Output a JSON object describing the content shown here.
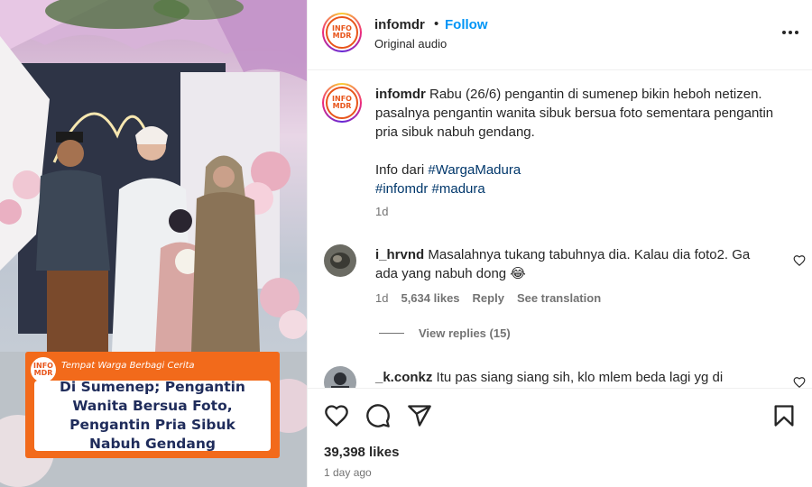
{
  "media": {
    "caption_tag": "Tempat Warga Berbagi Cerita",
    "caption_title": "Di Sumenep; Pengantin Wanita Bersua Foto, Pengantin Pria Sibuk Nabuh Gendang",
    "logo_line1": "INFO",
    "logo_line2": "MDR"
  },
  "header": {
    "username": "infomdr",
    "dot": "•",
    "follow_label": "Follow",
    "subtitle": "Original audio",
    "more_icon": "more-horizontal-icon"
  },
  "post_caption": {
    "username": "infomdr",
    "text": "Rabu (26/6) pengantin di sumenep bikin heboh netizen. pasalnya pengantin wanita sibuk bersua foto sementara pengantin pria sibuk nabuh gendang.",
    "info_prefix": "Info dari",
    "hashtag1": "#WargaMadura",
    "hashtag2": "#infomdr",
    "hashtag3": "#madura",
    "time": "1d"
  },
  "comments": [
    {
      "username": "i_hrvnd",
      "text": "Masalahnya tukang tabuhnya dia. Kalau dia foto2. Ga ada yang nabuh dong 😂",
      "time": "1d",
      "likes": "5,634 likes",
      "reply_label": "Reply",
      "translate_label": "See translation"
    },
    {
      "username": "_k.conkz",
      "text": "Itu pas siang siang sih, klo mlem beda lagi yg di"
    }
  ],
  "view_replies": "View replies (15)",
  "actions": {
    "like_icon": "heart-icon",
    "comment_icon": "comment-icon",
    "share_icon": "share-icon",
    "save_icon": "bookmark-icon",
    "likes_count": "39,398 likes",
    "posted_ago": "1 day ago"
  },
  "colors": {
    "follow_blue": "#0095f6",
    "hashtag_blue": "#00376b",
    "brand_orange": "#f26a1b",
    "caption_navy": "#1f2c5b"
  }
}
